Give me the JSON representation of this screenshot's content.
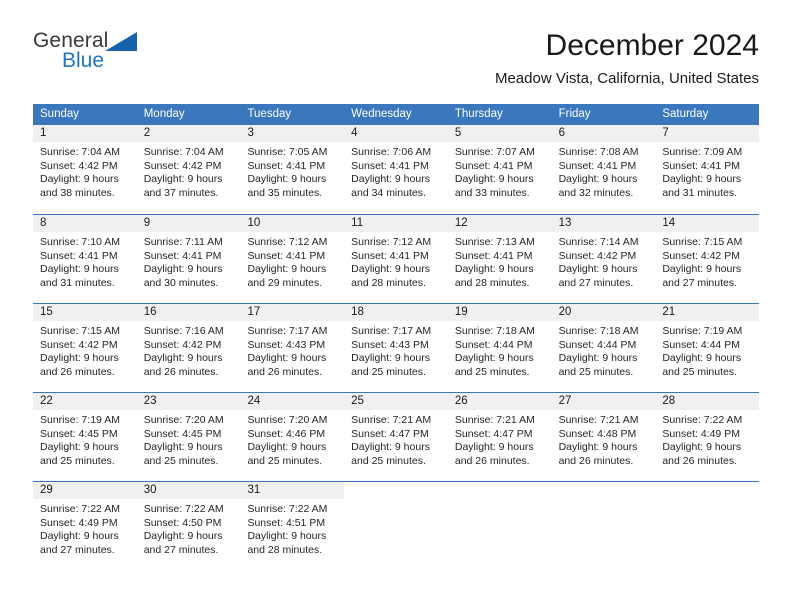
{
  "brand": {
    "name_top": "General",
    "name_bottom": "Blue",
    "triangle_icon": "triangle-icon",
    "color_top": "#3a3a3a",
    "color_bottom": "#1f74c4",
    "triangle_color": "#1763ab"
  },
  "header": {
    "title": "December 2024",
    "subtitle": "Meadow Vista, California, United States"
  },
  "theme": {
    "header_blue": "#3b77bd",
    "day_band_gray": "#f0f0f0",
    "text": "#262626"
  },
  "weekdays": [
    "Sunday",
    "Monday",
    "Tuesday",
    "Wednesday",
    "Thursday",
    "Friday",
    "Saturday"
  ],
  "weeks": [
    [
      {
        "day": "1",
        "sunrise": "Sunrise: 7:04 AM",
        "sunset": "Sunset: 4:42 PM",
        "daylight1": "Daylight: 9 hours",
        "daylight2": "and 38 minutes."
      },
      {
        "day": "2",
        "sunrise": "Sunrise: 7:04 AM",
        "sunset": "Sunset: 4:42 PM",
        "daylight1": "Daylight: 9 hours",
        "daylight2": "and 37 minutes."
      },
      {
        "day": "3",
        "sunrise": "Sunrise: 7:05 AM",
        "sunset": "Sunset: 4:41 PM",
        "daylight1": "Daylight: 9 hours",
        "daylight2": "and 35 minutes."
      },
      {
        "day": "4",
        "sunrise": "Sunrise: 7:06 AM",
        "sunset": "Sunset: 4:41 PM",
        "daylight1": "Daylight: 9 hours",
        "daylight2": "and 34 minutes."
      },
      {
        "day": "5",
        "sunrise": "Sunrise: 7:07 AM",
        "sunset": "Sunset: 4:41 PM",
        "daylight1": "Daylight: 9 hours",
        "daylight2": "and 33 minutes."
      },
      {
        "day": "6",
        "sunrise": "Sunrise: 7:08 AM",
        "sunset": "Sunset: 4:41 PM",
        "daylight1": "Daylight: 9 hours",
        "daylight2": "and 32 minutes."
      },
      {
        "day": "7",
        "sunrise": "Sunrise: 7:09 AM",
        "sunset": "Sunset: 4:41 PM",
        "daylight1": "Daylight: 9 hours",
        "daylight2": "and 31 minutes."
      }
    ],
    [
      {
        "day": "8",
        "sunrise": "Sunrise: 7:10 AM",
        "sunset": "Sunset: 4:41 PM",
        "daylight1": "Daylight: 9 hours",
        "daylight2": "and 31 minutes."
      },
      {
        "day": "9",
        "sunrise": "Sunrise: 7:11 AM",
        "sunset": "Sunset: 4:41 PM",
        "daylight1": "Daylight: 9 hours",
        "daylight2": "and 30 minutes."
      },
      {
        "day": "10",
        "sunrise": "Sunrise: 7:12 AM",
        "sunset": "Sunset: 4:41 PM",
        "daylight1": "Daylight: 9 hours",
        "daylight2": "and 29 minutes."
      },
      {
        "day": "11",
        "sunrise": "Sunrise: 7:12 AM",
        "sunset": "Sunset: 4:41 PM",
        "daylight1": "Daylight: 9 hours",
        "daylight2": "and 28 minutes."
      },
      {
        "day": "12",
        "sunrise": "Sunrise: 7:13 AM",
        "sunset": "Sunset: 4:41 PM",
        "daylight1": "Daylight: 9 hours",
        "daylight2": "and 28 minutes."
      },
      {
        "day": "13",
        "sunrise": "Sunrise: 7:14 AM",
        "sunset": "Sunset: 4:42 PM",
        "daylight1": "Daylight: 9 hours",
        "daylight2": "and 27 minutes."
      },
      {
        "day": "14",
        "sunrise": "Sunrise: 7:15 AM",
        "sunset": "Sunset: 4:42 PM",
        "daylight1": "Daylight: 9 hours",
        "daylight2": "and 27 minutes."
      }
    ],
    [
      {
        "day": "15",
        "sunrise": "Sunrise: 7:15 AM",
        "sunset": "Sunset: 4:42 PM",
        "daylight1": "Daylight: 9 hours",
        "daylight2": "and 26 minutes."
      },
      {
        "day": "16",
        "sunrise": "Sunrise: 7:16 AM",
        "sunset": "Sunset: 4:42 PM",
        "daylight1": "Daylight: 9 hours",
        "daylight2": "and 26 minutes."
      },
      {
        "day": "17",
        "sunrise": "Sunrise: 7:17 AM",
        "sunset": "Sunset: 4:43 PM",
        "daylight1": "Daylight: 9 hours",
        "daylight2": "and 26 minutes."
      },
      {
        "day": "18",
        "sunrise": "Sunrise: 7:17 AM",
        "sunset": "Sunset: 4:43 PM",
        "daylight1": "Daylight: 9 hours",
        "daylight2": "and 25 minutes."
      },
      {
        "day": "19",
        "sunrise": "Sunrise: 7:18 AM",
        "sunset": "Sunset: 4:44 PM",
        "daylight1": "Daylight: 9 hours",
        "daylight2": "and 25 minutes."
      },
      {
        "day": "20",
        "sunrise": "Sunrise: 7:18 AM",
        "sunset": "Sunset: 4:44 PM",
        "daylight1": "Daylight: 9 hours",
        "daylight2": "and 25 minutes."
      },
      {
        "day": "21",
        "sunrise": "Sunrise: 7:19 AM",
        "sunset": "Sunset: 4:44 PM",
        "daylight1": "Daylight: 9 hours",
        "daylight2": "and 25 minutes."
      }
    ],
    [
      {
        "day": "22",
        "sunrise": "Sunrise: 7:19 AM",
        "sunset": "Sunset: 4:45 PM",
        "daylight1": "Daylight: 9 hours",
        "daylight2": "and 25 minutes."
      },
      {
        "day": "23",
        "sunrise": "Sunrise: 7:20 AM",
        "sunset": "Sunset: 4:45 PM",
        "daylight1": "Daylight: 9 hours",
        "daylight2": "and 25 minutes."
      },
      {
        "day": "24",
        "sunrise": "Sunrise: 7:20 AM",
        "sunset": "Sunset: 4:46 PM",
        "daylight1": "Daylight: 9 hours",
        "daylight2": "and 25 minutes."
      },
      {
        "day": "25",
        "sunrise": "Sunrise: 7:21 AM",
        "sunset": "Sunset: 4:47 PM",
        "daylight1": "Daylight: 9 hours",
        "daylight2": "and 25 minutes."
      },
      {
        "day": "26",
        "sunrise": "Sunrise: 7:21 AM",
        "sunset": "Sunset: 4:47 PM",
        "daylight1": "Daylight: 9 hours",
        "daylight2": "and 26 minutes."
      },
      {
        "day": "27",
        "sunrise": "Sunrise: 7:21 AM",
        "sunset": "Sunset: 4:48 PM",
        "daylight1": "Daylight: 9 hours",
        "daylight2": "and 26 minutes."
      },
      {
        "day": "28",
        "sunrise": "Sunrise: 7:22 AM",
        "sunset": "Sunset: 4:49 PM",
        "daylight1": "Daylight: 9 hours",
        "daylight2": "and 26 minutes."
      }
    ],
    [
      {
        "day": "29",
        "sunrise": "Sunrise: 7:22 AM",
        "sunset": "Sunset: 4:49 PM",
        "daylight1": "Daylight: 9 hours",
        "daylight2": "and 27 minutes."
      },
      {
        "day": "30",
        "sunrise": "Sunrise: 7:22 AM",
        "sunset": "Sunset: 4:50 PM",
        "daylight1": "Daylight: 9 hours",
        "daylight2": "and 27 minutes."
      },
      {
        "day": "31",
        "sunrise": "Sunrise: 7:22 AM",
        "sunset": "Sunset: 4:51 PM",
        "daylight1": "Daylight: 9 hours",
        "daylight2": "and 28 minutes."
      },
      {
        "day": "",
        "sunrise": "",
        "sunset": "",
        "daylight1": "",
        "daylight2": ""
      },
      {
        "day": "",
        "sunrise": "",
        "sunset": "",
        "daylight1": "",
        "daylight2": ""
      },
      {
        "day": "",
        "sunrise": "",
        "sunset": "",
        "daylight1": "",
        "daylight2": ""
      },
      {
        "day": "",
        "sunrise": "",
        "sunset": "",
        "daylight1": "",
        "daylight2": ""
      }
    ]
  ]
}
